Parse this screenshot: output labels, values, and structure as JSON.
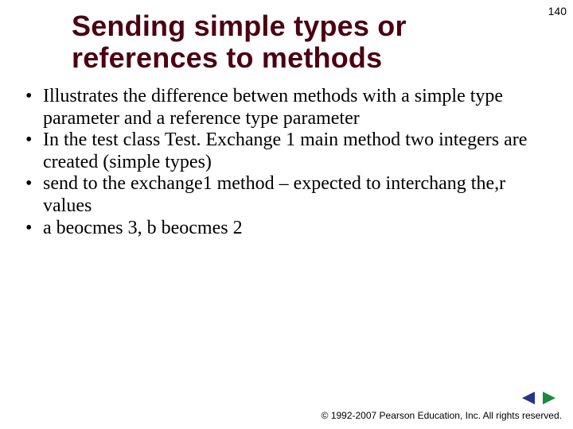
{
  "page_number": "140",
  "title": "Sending simple types or references to methods",
  "bullets": [
    "Illustrates the difference betwen methods with a simple type parameter and a reference type parameter",
    "In the test class Test. Exchange 1 main method two integers are created (simple types)",
    "send to the  exchange1 method – expected to interchang the,r values",
    "a beocmes 3, b beocmes 2"
  ],
  "footer": "© 1992-2007 Pearson Education, Inc.  All rights reserved.",
  "nav": {
    "prev_color": "#28348a",
    "next_color": "#1a8a3c"
  }
}
